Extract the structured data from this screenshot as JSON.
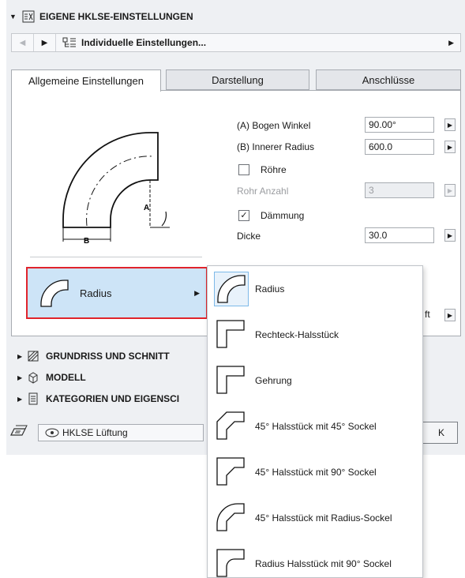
{
  "header": {
    "title": "EIGENE HKLSE-EINSTELLUNGEN"
  },
  "nav": {
    "label": "Individuelle Einstellungen..."
  },
  "tabs": [
    {
      "label": "Allgemeine Einstellungen",
      "active": true
    },
    {
      "label": "Darstellung",
      "active": false
    },
    {
      "label": "Anschlüsse",
      "active": false
    }
  ],
  "preview": {
    "label_a": "A",
    "label_b": "B"
  },
  "fields": {
    "bogen_winkel": {
      "label": "(A) Bogen Winkel",
      "value": "90.00°"
    },
    "innerer_radius": {
      "label": "(B) Innerer Radius",
      "value": "600.0"
    },
    "roehre": {
      "label": "Röhre",
      "checked": false
    },
    "rohr_anzahl": {
      "label": "Rohr Anzahl",
      "value": "3",
      "disabled": true
    },
    "daemmung": {
      "label": "Dämmung",
      "checked": true
    },
    "dicke": {
      "label": "Dicke",
      "value": "30.0"
    }
  },
  "radius_button": {
    "label": "Radius"
  },
  "partial": {
    "ft": "ft",
    "ok_fragment": "K"
  },
  "collapsed_sections": [
    {
      "label": "GRUNDRISS UND SCHNITT"
    },
    {
      "label": "MODELL"
    },
    {
      "label": "KATEGORIEN UND EIGENSCI"
    }
  ],
  "footer": {
    "favorite": "HKLSE Lüftung"
  },
  "popup": {
    "items": [
      {
        "label": "Radius",
        "icon": "radius-elbow-icon",
        "selected": true
      },
      {
        "label": "Rechteck-Halsstück",
        "icon": "rect-throat-icon",
        "selected": false
      },
      {
        "label": "Gehrung",
        "icon": "mitre-icon",
        "selected": false
      },
      {
        "label": "45° Halsstück mit 45° Sockel",
        "icon": "throat45-heel45-icon",
        "selected": false
      },
      {
        "label": "45° Halsstück mit 90° Sockel",
        "icon": "throat45-heel90-icon",
        "selected": false
      },
      {
        "label": "45° Halsstück mit Radius-Sockel",
        "icon": "throat45-radius-heel-icon",
        "selected": false
      },
      {
        "label": "Radius Halsstück mit 90° Sockel",
        "icon": "radius-throat-heel90-icon",
        "selected": false
      }
    ]
  }
}
